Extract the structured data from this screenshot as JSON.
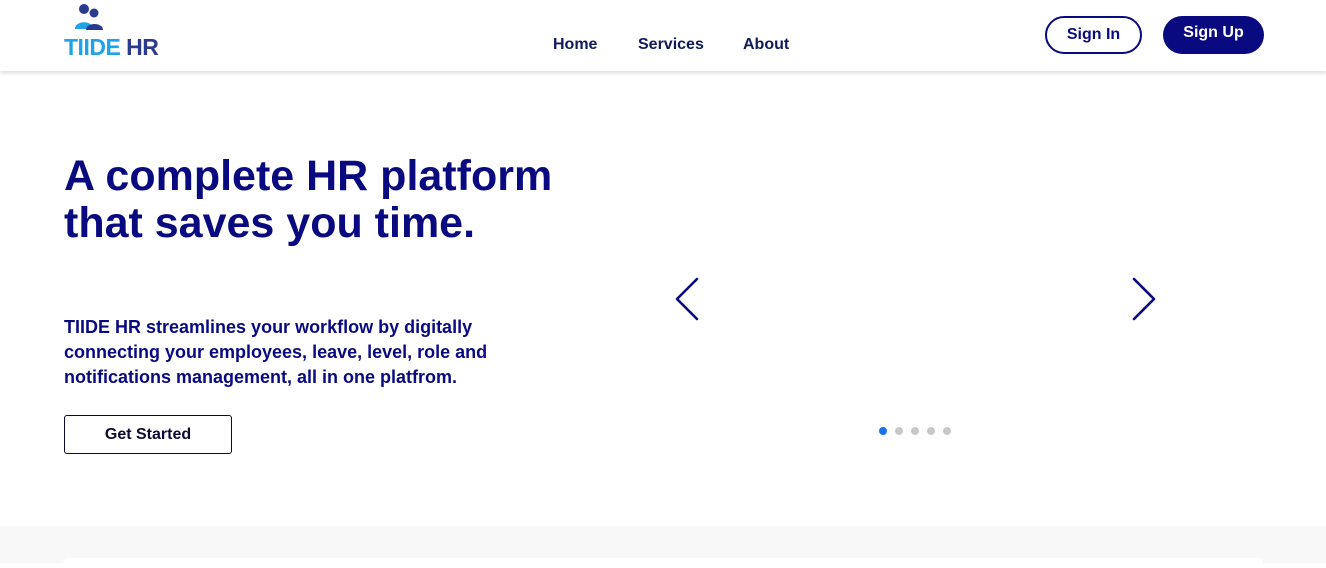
{
  "brand": {
    "logo_part1": "TIIDE",
    "logo_part2": "HR",
    "colors": {
      "primary": "#0a0a80",
      "logo_blue": "#1fa3e8",
      "logo_dark": "#2a3a8f",
      "dot_active": "#1a73e8",
      "dot_inactive": "#c8c8c8"
    }
  },
  "nav": {
    "items": [
      {
        "label": "Home"
      },
      {
        "label": "Services"
      },
      {
        "label": "About"
      }
    ]
  },
  "auth": {
    "sign_in": "Sign In",
    "sign_up": "Sign Up"
  },
  "hero": {
    "title": "A complete HR platform that saves you time.",
    "description": "TIIDE HR streamlines your workflow by digitally connecting your employees, leave, level, role and notifications management, all in one platfrom.",
    "cta": "Get Started"
  },
  "carousel": {
    "prev_icon": "chevron-left-icon",
    "next_icon": "chevron-right-icon",
    "slide_count": 5,
    "active_slide": 1
  }
}
